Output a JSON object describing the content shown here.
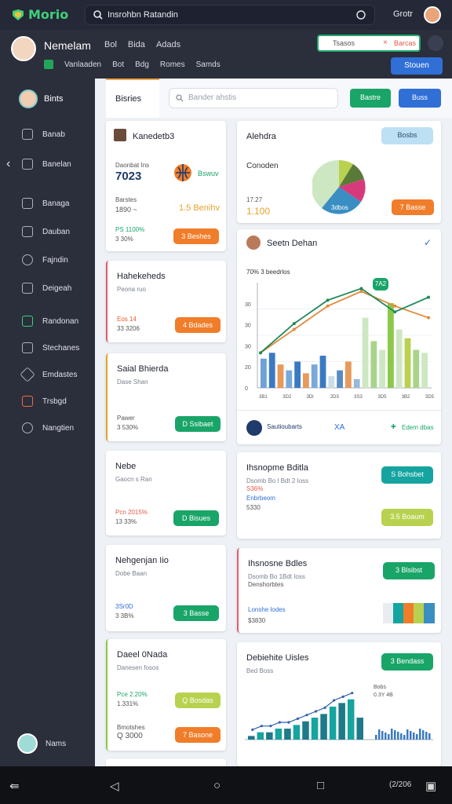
{
  "app": {
    "name": "Morio"
  },
  "topbar": {
    "search_text": "Insrohbn Ratandin",
    "user_name": "Grotr"
  },
  "header": {
    "title": "Nemelam",
    "nav": [
      "Bol",
      "Bida",
      "Adads"
    ],
    "sub_nav": [
      "Vanlaaden",
      "Bot",
      "Bdg",
      "Romes",
      "Samds"
    ],
    "field_text": "Tsasos",
    "field_action": "Barcas",
    "button": "Stouen"
  },
  "sidebar": {
    "user": "Bints",
    "items": [
      "Banab",
      "Banelan",
      "Banaga",
      "Dauban",
      "Fajndin",
      "Deigeah",
      "Randonan",
      "Stechanes",
      "Emdastes",
      "Trsbgd",
      "Nangtien"
    ],
    "bottom_user": "Nams"
  },
  "tabs": {
    "active": "Bisries",
    "search_placeholder": "Bander ahstis",
    "btn_green": "Bastre",
    "btn_blue": "Buss"
  },
  "cards_left": [
    {
      "title": "Kanedetb3",
      "sub": "Daonbat Ins",
      "value": "7023",
      "value_label": "Bswuv",
      "line1": "Barstes",
      "line2": "1890 ~",
      "accent": "1.5 Benihv",
      "pct": "PS 1100%",
      "pct2": "3 30%",
      "button": "3 Beshes"
    },
    {
      "title": "Hahekeheds",
      "sub": "Peona ruo",
      "pct": "Eos 14",
      "pct2": "33 3206",
      "button": "4 Bdades"
    },
    {
      "title": "Saial Bhierda",
      "sub": "Dase Shan",
      "pct": "Pawer",
      "pct2": "3 530%",
      "button": "D Ssibaet"
    },
    {
      "title": "Nebe",
      "sub": "Gaocn s Ran",
      "pct": "Pcn 2015%",
      "pct2": "13 33%",
      "button": "D Bisues"
    },
    {
      "title": "Nehgenjan Iio",
      "sub": "Dobe Baan",
      "pct": "3Sr0D",
      "pct2": "3 3B%",
      "button": "3 Basse"
    },
    {
      "title": "Daeel 0Nada",
      "sub": "Danesen fosos",
      "pct": "Pce 2.20%",
      "pct2": "1.331%",
      "line1": "Bmotshes",
      "line2": "Q 3000",
      "button": "Q Bosdas",
      "button2": "7 Basone"
    }
  ],
  "pie_card": {
    "title": "Alehdra",
    "badge": "Bosbs",
    "label": "Conoden",
    "value": "17.27",
    "value2": "1.100",
    "pie_label": "3dbos",
    "button": "7 Basse"
  },
  "combo_card": {
    "title": "Seetn Dehan",
    "subtitle": "70% 3 beedrlos",
    "badge": "7A2",
    "footer_left": "Sautioubarts",
    "footer_mid": "XA",
    "footer_right": "Edem dbas",
    "chart_data": {
      "type": "bar",
      "x_tick_labels": [
        "3B1",
        "3D2",
        "3Dl",
        "2D3",
        "3S3",
        "3D5",
        "3B2",
        "3D5"
      ],
      "y_ticks": [
        0,
        20,
        30,
        30,
        30
      ],
      "bars": [
        10,
        12,
        8,
        6,
        9,
        5,
        8,
        11,
        4,
        6,
        9,
        3,
        24,
        16,
        13,
        29,
        20,
        17,
        13,
        12
      ],
      "line_green": [
        12,
        22,
        30,
        34,
        26,
        31
      ],
      "line_orange": [
        12,
        20,
        28,
        33,
        28,
        24
      ]
    }
  },
  "rect_cards": [
    {
      "title": "Ihsnopme Bditla",
      "sub": "Dsomb Bo l Bdt 2 Ioss",
      "line1": "S36%",
      "line2": "Enbrbeom",
      "line3": "5330",
      "button": "S Bohsbet",
      "button2": "3.5 Boaum"
    },
    {
      "title": "Ihsnosne Bdles",
      "sub": "Dsomb Bo 1Bdt Ioss",
      "line1": "Denshorbtes",
      "line2": "Lonshe lodes",
      "line3": "$3830",
      "button": "3 Blsibst"
    }
  ],
  "last_card": {
    "title": "Debiehite Uisles",
    "sub": "Bed Boss",
    "button": "3 Bendass",
    "legend1": "Bobs",
    "legend2": "0.3Y 4B",
    "chart_data": {
      "type": "bar",
      "values": [
        1,
        2,
        2,
        3,
        3,
        4,
        5,
        6,
        7,
        9,
        10,
        11,
        6
      ]
    }
  },
  "navbar": {
    "time": "(2/206"
  }
}
